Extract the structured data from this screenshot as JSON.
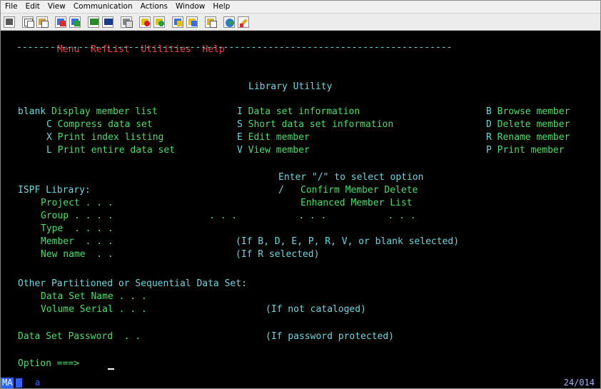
{
  "menubar": [
    "File",
    "Edit",
    "View",
    "Communication",
    "Actions",
    "Window",
    "Help"
  ],
  "toolbar_icons": [
    "display-icon",
    "copy-icon",
    "paste-icon",
    "send-icon",
    "receive-icon",
    "keypad-icon",
    "macro-icon",
    "print-icon",
    "record-icon",
    "play-icon",
    "transfer-icon",
    "transfer-receive-icon",
    "clipboard-icon",
    "globe-icon",
    "edit-icon"
  ],
  "ispf_menu": [
    "Menu",
    "RefList",
    "Utilities",
    "Help"
  ],
  "separator": "------------------------------------------------------------------------------",
  "title": "Library Utility",
  "options": {
    "col1": [
      {
        "key": "blank",
        "label": "Display member list"
      },
      {
        "key": "C",
        "label": "Compress data set"
      },
      {
        "key": "X",
        "label": "Print index listing"
      },
      {
        "key": "L",
        "label": "Print entire data set"
      }
    ],
    "col2": [
      {
        "key": "I",
        "label": "Data set information"
      },
      {
        "key": "S",
        "label": "Short data set information"
      },
      {
        "key": "E",
        "label": "Edit member"
      },
      {
        "key": "V",
        "label": "View member"
      }
    ],
    "col3": [
      {
        "key": "B",
        "label": "Browse member"
      },
      {
        "key": "D",
        "label": "Delete member"
      },
      {
        "key": "R",
        "label": "Rename member"
      },
      {
        "key": "P",
        "label": "Print member"
      }
    ]
  },
  "select_hint": "Enter \"/\" to select option",
  "confirm_delete": {
    "value": "/",
    "label": "Confirm Member Delete"
  },
  "enhanced_list": {
    "label": "Enhanced Member List"
  },
  "ispf_library": "ISPF Library:",
  "fields": {
    "project": "Project . . .",
    "group": "Group . . . .",
    "group_dots": ". . .           . . .           . . .",
    "type": "Type  . . . .",
    "member": "Member  . . .",
    "member_note": "(If B, D, E, P, R, V, or blank selected)",
    "new_name": "New name  . .",
    "new_name_note": "(If R selected)"
  },
  "other": {
    "heading": "Other Partitioned or Sequential Data Set:",
    "dsn": "Data Set Name . . .",
    "volser": "Volume Serial . . .",
    "volser_note": "(If not cataloged)"
  },
  "password": {
    "label": "Data Set Password  . .",
    "note": "(If password protected)"
  },
  "option_prompt": "Option ===>",
  "status": {
    "mode": "MA",
    "session": "a",
    "position": "24/014"
  }
}
